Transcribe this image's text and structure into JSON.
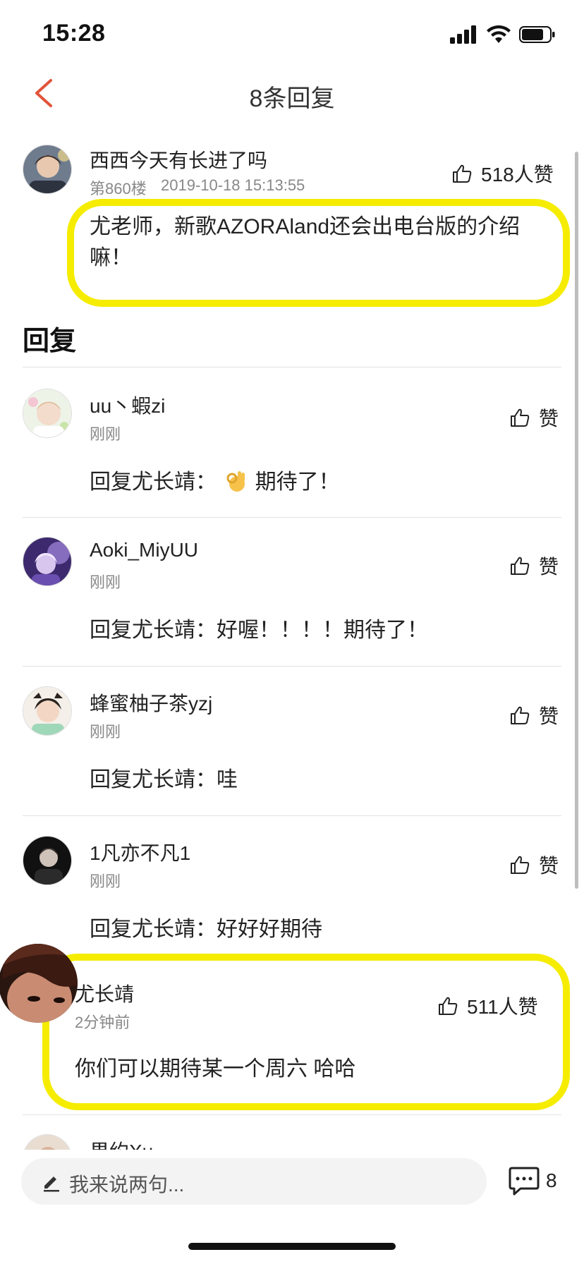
{
  "status_bar": {
    "time": "15:28"
  },
  "nav": {
    "title": "8条回复"
  },
  "main_comment": {
    "user": "西西今天有长进了吗",
    "floor": "第860楼",
    "timestamp": "2019-10-18 15:13:55",
    "likes": "518人赞",
    "text": "尤老师，新歌AZORAland还会出电台版的介绍嘛！"
  },
  "section_title": "回复",
  "replies": [
    {
      "user": "uu丶蝦zi",
      "time": "刚刚",
      "like_label": "赞",
      "text_before": "回复尤长靖：",
      "emoji": "ok-hand-emoji",
      "text_after": "期待了！"
    },
    {
      "user": "Aoki_MiyUU",
      "time": "刚刚",
      "like_label": "赞",
      "text": "回复尤长靖：好喔！！！！期待了！"
    },
    {
      "user": "蜂蜜柚子茶yzj",
      "time": "刚刚",
      "like_label": "赞",
      "text": "回复尤长靖：哇"
    },
    {
      "user": "1凡亦不凡1",
      "time": "刚刚",
      "like_label": "赞",
      "text": "回复尤长靖：好好好期待"
    },
    {
      "user": "尤长靖",
      "time": "2分钟前",
      "likes": "511人赞",
      "text": "你们可以期待某一个周六 哈哈"
    },
    {
      "user": "果约Xu"
    }
  ],
  "input": {
    "placeholder": "我来说两句..."
  },
  "comment_count": "8",
  "colors": {
    "highlight": "#f5ec00",
    "accent": "#e2533a"
  }
}
